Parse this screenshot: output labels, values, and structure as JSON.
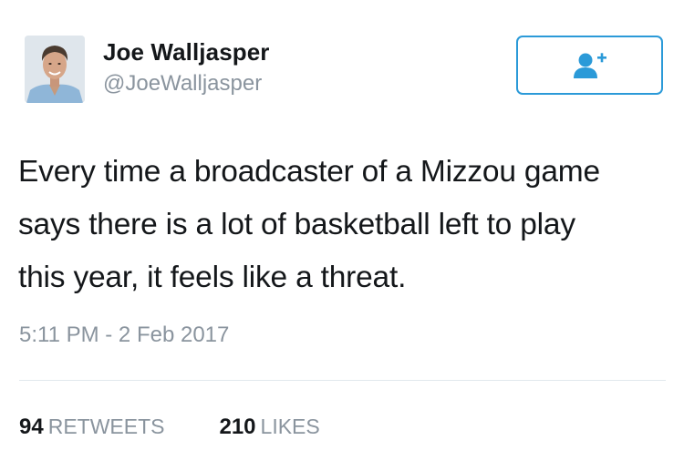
{
  "author": {
    "display_name": "Joe Walljasper",
    "handle": "@JoeWalljasper",
    "avatar": "profile-photo"
  },
  "follow_button": {
    "icon": "add-user-icon",
    "color": "#2b9ad8"
  },
  "tweet": {
    "text_lines": [
      "Every time a broadcaster of a Mizzou game",
      "says there is a lot of basketball left to play",
      "this year, it feels like a threat."
    ],
    "timestamp": "5:11 PM - 2 Feb 2017"
  },
  "stats": {
    "retweets_count": "94",
    "retweets_label": "RETWEETS",
    "likes_count": "210",
    "likes_label": "LIKES"
  },
  "colors": {
    "text": "#14171a",
    "secondary": "#8a949e",
    "accent": "#2b9ad8",
    "divider": "#e1e8ed"
  }
}
